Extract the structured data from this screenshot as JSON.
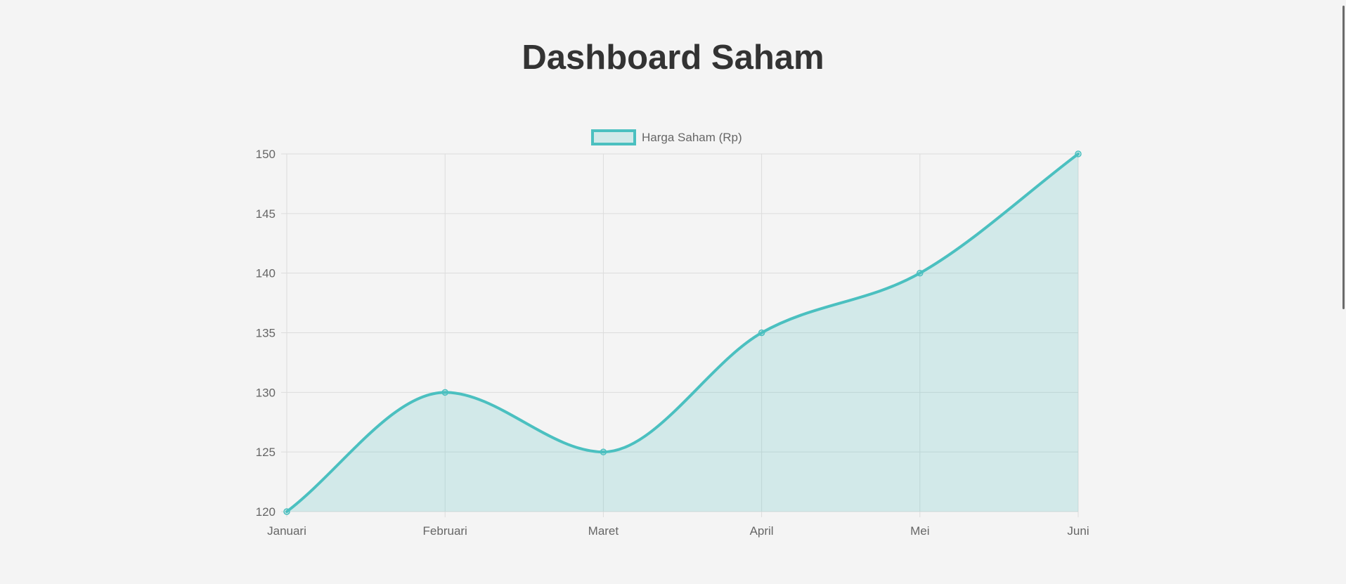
{
  "page": {
    "title": "Dashboard Saham"
  },
  "colors": {
    "line": "#4bc0c0",
    "fill": "rgba(75,192,192,0.2)",
    "grid": "#dcdcdc",
    "text": "#666666"
  },
  "chart_data": {
    "type": "line",
    "filled": true,
    "smooth": true,
    "categories": [
      "Januari",
      "Februari",
      "Maret",
      "April",
      "Mei",
      "Juni"
    ],
    "series": [
      {
        "name": "Harga Saham (Rp)",
        "values": [
          120,
          130,
          125,
          135,
          140,
          150
        ]
      }
    ],
    "ylim": [
      120,
      150
    ],
    "yticks": [
      "120",
      "125",
      "130",
      "135",
      "140",
      "145",
      "150"
    ],
    "grid": true,
    "legend_position": "top-center"
  }
}
